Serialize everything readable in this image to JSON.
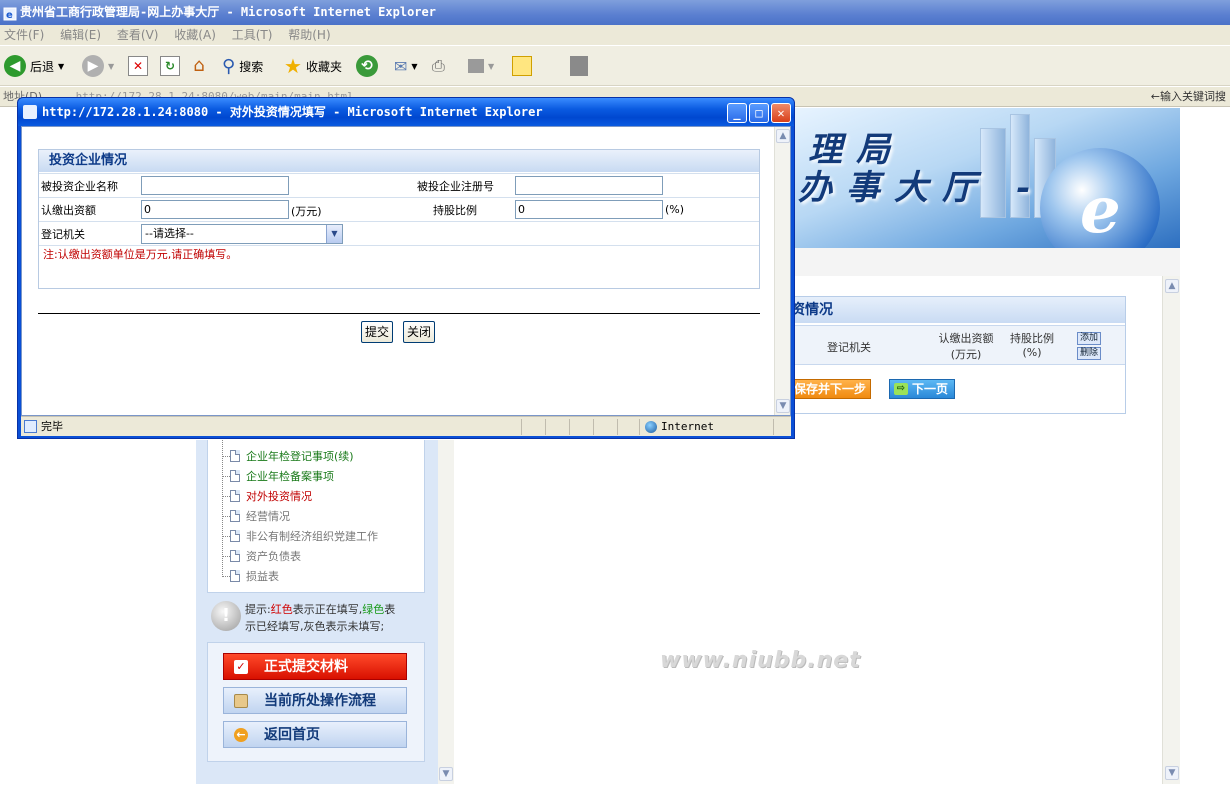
{
  "main_window": {
    "title": "贵州省工商行政管理局-网上办事大厅 - Microsoft Internet Explorer",
    "menu": [
      "文件(F)",
      "编辑(E)",
      "查看(V)",
      "收藏(A)",
      "工具(T)",
      "帮助(H)"
    ],
    "toolbar": {
      "back_label": "后退",
      "search_label": "搜索",
      "favorites_label": "收藏夹"
    },
    "address_label": "地址(D)",
    "address_value": "http://172.28.1.24:8080/web/main/main.html",
    "keyword_hint": "←输入关键词搜"
  },
  "banner": {
    "text_line1": "理局",
    "text_line2": "办事大厅 -"
  },
  "content_panel": {
    "title": "资情况",
    "col_registry": "登记机关",
    "col_amount_line1": "认缴出资额",
    "col_amount_line2": "(万元)",
    "col_ratio_line1": "持股比例",
    "col_ratio_line2": "(%)",
    "add_label": "添加",
    "delete_label": "删除",
    "save_next_label": "保存并下一步",
    "next_page_label": "下一页"
  },
  "nav": {
    "items": [
      {
        "label": "企业年检登记事项(续)",
        "color": "#1a7a1a"
      },
      {
        "label": "企业年检备案事项",
        "color": "#1a7a1a"
      },
      {
        "label": "对外投资情况",
        "color": "#c00000"
      },
      {
        "label": "经营情况",
        "color": "#777777"
      },
      {
        "label": "非公有制经济组织党建工作",
        "color": "#777777"
      },
      {
        "label": "资产负债表",
        "color": "#777777"
      },
      {
        "label": "损益表",
        "color": "#777777"
      }
    ],
    "hint_prefix": "提示:",
    "hint_red": "红色",
    "hint_mid": "表示正在填写,",
    "hint_green": "绿色",
    "hint_suffix": "表",
    "hint_line2": "示已经填写,灰色表示未填写;",
    "submit_label": "正式提交材料",
    "flow_label": "当前所处操作流程",
    "home_label": "返回首页"
  },
  "watermark": "www.niubb.net",
  "popup": {
    "title": "http://172.28.1.24:8080 - 对外投资情况填写 - Microsoft Internet Explorer",
    "section_title": "投资企业情况",
    "company_name_label": "被投资企业名称",
    "company_name_value": "",
    "reg_no_label": "被投企业注册号",
    "reg_no_value": "",
    "amount_label": "认缴出资额",
    "amount_value": "0",
    "amount_unit": "(万元)",
    "ratio_label": "持股比例",
    "ratio_value": "0",
    "ratio_unit": "(%)",
    "registry_label": "登记机关",
    "registry_selected": "--请选择--",
    "note": "注:认缴出资额单位是万元,请正确填写。",
    "submit_label": "提交",
    "close_label": "关闭",
    "status_text": "完毕",
    "zone_text": "Internet"
  }
}
